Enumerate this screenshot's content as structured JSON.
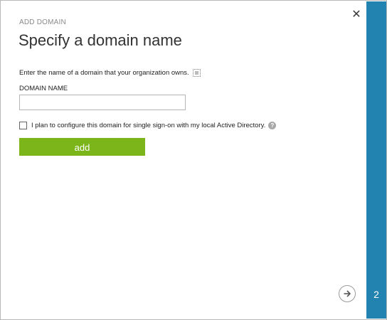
{
  "dialog": {
    "eyebrow": "ADD DOMAIN",
    "title": "Specify a domain name",
    "close_icon": "close-icon",
    "instruction": "Enter the name of a domain that your organization owns.",
    "field_label": "DOMAIN NAME",
    "domain_input": {
      "value": "",
      "placeholder": ""
    },
    "sso_checkbox": {
      "label": "I plan to configure this domain for single sign-on with my local Active Directory.",
      "checked": false
    },
    "help_icon_glyph": "?",
    "add_button_label": "add",
    "next_icon": "arrow-right-icon"
  },
  "side_panel": {
    "step": "2",
    "color": "#2383b0"
  },
  "colors": {
    "accent_green": "#7bb51a",
    "side_blue": "#2383b0"
  }
}
